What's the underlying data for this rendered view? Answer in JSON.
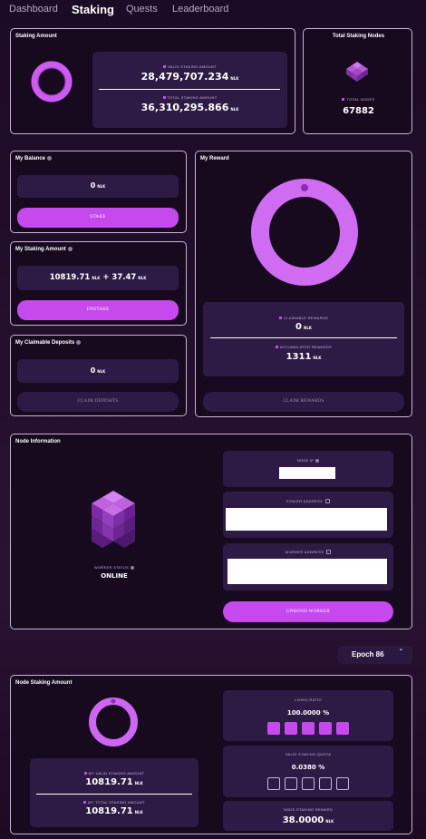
{
  "nav": {
    "tabs": [
      {
        "label": "Dashboard"
      },
      {
        "label": "Staking"
      },
      {
        "label": "Quests"
      },
      {
        "label": "Leaderboard"
      }
    ]
  },
  "staking_amount": {
    "title": "Staking Amount",
    "valid_label": "VALID STAKING AMOUNT",
    "valid_value": "28,479,707.234",
    "total_label": "TOTAL STAKING AMOUNT",
    "total_value": "36,310,295.866",
    "unit": "NLK"
  },
  "total_nodes": {
    "title": "Total Staking Nodes",
    "label": "TOTAL NODES",
    "value": "67882"
  },
  "my_balance": {
    "title": "My Balance",
    "value": "0",
    "unit": "NLK",
    "stake_label": "STAKE"
  },
  "my_staking": {
    "title": "My Staking Amount",
    "value_a": "10819.71",
    "plus": "+",
    "value_b": "37.47",
    "unit": "NLK",
    "unstake_label": "UNSTAKE"
  },
  "claimable_deposits": {
    "title": "My Claimable Deposits",
    "value": "0",
    "unit": "NLK",
    "button_label": "CLAIM DEPOSITS"
  },
  "my_reward": {
    "title": "My Reward",
    "claimable_label": "CLAIMABLE REWARDS",
    "claimable_value": "0",
    "accumulated_label": "ACCUMULATED REWARDS",
    "accumulated_value": "1311",
    "unit": "NLK",
    "button_label": "CLAIM REWARDS"
  },
  "node_info": {
    "title": "Node Information",
    "status_label": "WORKER STATUS",
    "status_value": "ONLINE",
    "node_ip_label": "NODE IP",
    "staker_address_label": "STAKER ADDRESS",
    "worker_address_label": "WORKER ADDRESS",
    "unbond_label": "UNBOND WORKER"
  },
  "epoch": {
    "label": "Epoch 86",
    "chevron": "ˇ"
  },
  "node_staking": {
    "title": "Node Staking Amount",
    "valid_label": "MY VALID STAKING AMOUNT",
    "valid_value": "10819.71",
    "total_label": "MY TOTAL STAKING AMOUNT",
    "total_value": "10819.71",
    "unit": "NLK",
    "living_ratio_label": "LIVING RATIO",
    "living_ratio_value": "100.0000 %",
    "living_ratio_filled": 5,
    "quota_label": "VALID STAKING QUOTA",
    "quota_value": "0.0380 %",
    "quota_filled": 0,
    "reward_label": "NODE STAKING REWARD",
    "reward_value": "38.0000",
    "reward_unit": "NLK"
  },
  "colors": {
    "accent": "#c649ee",
    "card_bg": "#170a1f",
    "panel_bg": "#2e1b45",
    "border": "#c8b6d6"
  }
}
